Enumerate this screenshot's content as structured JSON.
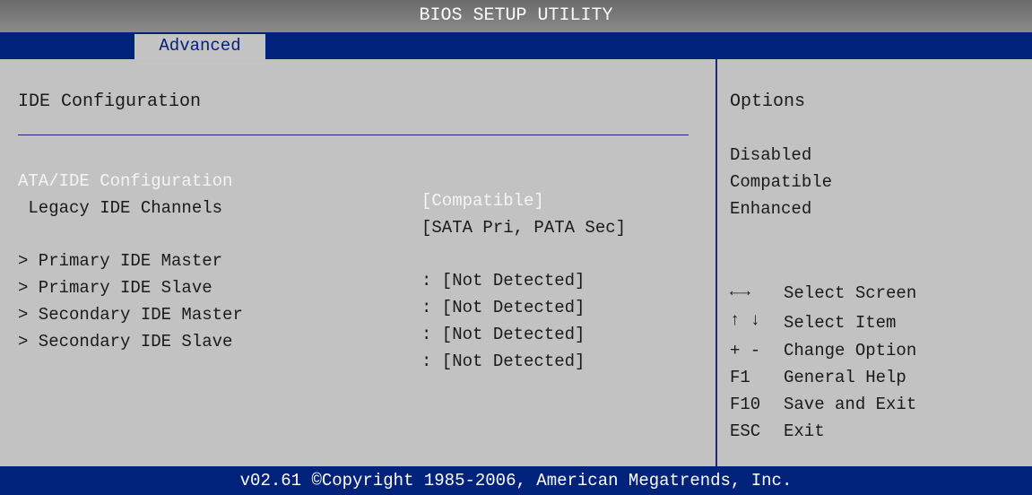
{
  "window": {
    "title": "BIOS SETUP UTILITY"
  },
  "tabs": [
    {
      "label": "Advanced"
    }
  ],
  "main": {
    "heading": "IDE Configuration",
    "items": [
      {
        "label": "ATA/IDE Configuration",
        "value": "[Compatible]",
        "selected": true
      },
      {
        "label": " Legacy IDE Channels",
        "value": "[SATA Pri, PATA Sec]"
      },
      {
        "label": "> Primary IDE Master",
        "value": ": [Not Detected]"
      },
      {
        "label": "> Primary IDE Slave",
        "value": ": [Not Detected]"
      },
      {
        "label": "> Secondary IDE Master",
        "value": ": [Not Detected]"
      },
      {
        "label": "> Secondary IDE Slave",
        "value": ": [Not Detected]"
      }
    ]
  },
  "help": {
    "title": "Options",
    "options": [
      "Disabled",
      "Compatible",
      "Enhanced"
    ],
    "keys": [
      {
        "key": "←→",
        "desc": "Select Screen"
      },
      {
        "key": "↑ ↓",
        "desc": "Select Item"
      },
      {
        "key": "+ -",
        "desc": "Change Option"
      },
      {
        "key": "F1",
        "desc": "General Help"
      },
      {
        "key": "F10",
        "desc": "Save and Exit"
      },
      {
        "key": "ESC",
        "desc": "Exit"
      }
    ]
  },
  "footer": {
    "text": "v02.61 ©Copyright 1985-2006, American Megatrends, Inc."
  },
  "colors": {
    "navy": "#00227a",
    "panel": "#c2c2c2",
    "highlight": "#f4f4f4"
  }
}
